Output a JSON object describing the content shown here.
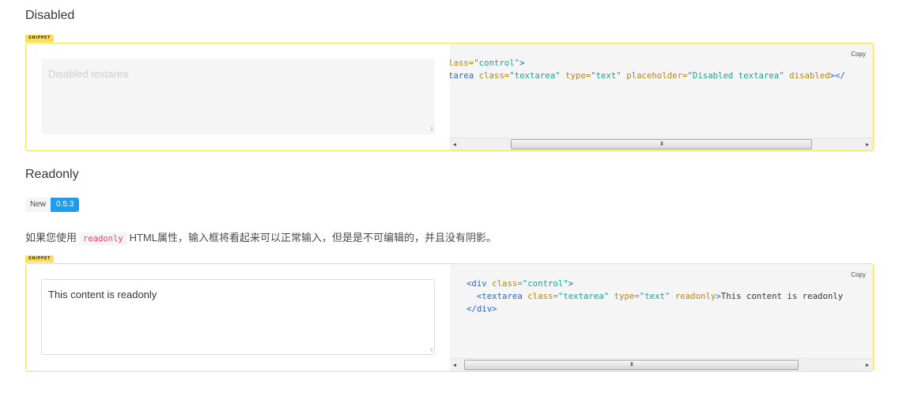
{
  "disabled_section": {
    "title": "Disabled",
    "snippet_label": "SNIPPET",
    "textarea_placeholder": "Disabled textarea",
    "copy_label": "Copy",
    "code_line1_tag_open": "lass=\"control\">",
    "code_line2": "tarea class=\"textarea\" type=\"text\" placeholder=\"Disabled textarea\" disabled></",
    "code_lines": [
      [
        {
          "t": "lass=",
          "c": "at"
        },
        {
          "t": "\"control\"",
          "c": "st"
        },
        {
          "t": ">",
          "c": "tg"
        }
      ],
      [
        {
          "t": "tarea ",
          "c": "tg"
        },
        {
          "t": "class=",
          "c": "at"
        },
        {
          "t": "\"textarea\"",
          "c": "st"
        },
        {
          "t": " type=",
          "c": "at"
        },
        {
          "t": "\"text\"",
          "c": "st"
        },
        {
          "t": " placeholder=",
          "c": "at"
        },
        {
          "t": "\"Disabled textarea\"",
          "c": "st"
        },
        {
          "t": " disabled",
          "c": "at"
        },
        {
          "t": "></",
          "c": "tg"
        }
      ]
    ],
    "scroll_grip": "III"
  },
  "readonly_section": {
    "title": "Readonly",
    "tag_new": "New",
    "tag_version": "0.5.3",
    "description_before": "如果您使用",
    "description_code": "readonly",
    "description_after": "HTML属性，输入框将看起来可以正常输入，但是是不可编辑的，并且没有阴影。",
    "snippet_label": "SNIPPET",
    "textarea_value": "This content is readonly",
    "copy_label": "Copy",
    "code_lines": [
      [
        {
          "t": "<div ",
          "c": "tg"
        },
        {
          "t": "class=",
          "c": "at"
        },
        {
          "t": "\"control\"",
          "c": "st"
        },
        {
          "t": ">",
          "c": "tg"
        }
      ],
      [
        {
          "t": "  <textarea ",
          "c": "tg"
        },
        {
          "t": "class=",
          "c": "at"
        },
        {
          "t": "\"textarea\"",
          "c": "st"
        },
        {
          "t": " type=",
          "c": "at"
        },
        {
          "t": "\"text\"",
          "c": "st"
        },
        {
          "t": " readonly",
          "c": "at"
        },
        {
          "t": ">",
          "c": "tg"
        },
        {
          "t": "This content is readonly",
          "c": "tx"
        }
      ],
      [
        {
          "t": "</div>",
          "c": "tg"
        }
      ]
    ],
    "scroll_grip": "III"
  },
  "scroll_arrows": {
    "left": "◂",
    "right": "▸"
  }
}
